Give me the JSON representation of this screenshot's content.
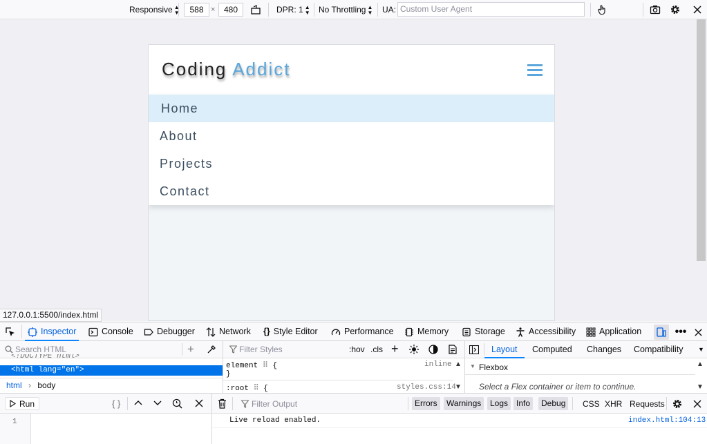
{
  "rdm": {
    "device": "Responsive",
    "width": "588",
    "height": "480",
    "times": "×",
    "dpr": "DPR: 1",
    "throttling": "No Throttling",
    "ua_label": "UA:",
    "ua_placeholder": "Custom User Agent"
  },
  "site": {
    "logo_part1": "Coding",
    "logo_part2": "Addict",
    "nav": [
      "Home",
      "About",
      "Projects",
      "Contact"
    ],
    "active_index": 0,
    "accent": "#5ba7db"
  },
  "status_url": "127.0.0.1:5500/index.html",
  "devtools": {
    "tabs": [
      "Inspector",
      "Console",
      "Debugger",
      "Network",
      "Style Editor",
      "Performance",
      "Memory",
      "Storage",
      "Accessibility",
      "Application"
    ],
    "selected_tab": "Inspector",
    "inspector": {
      "search_placeholder": "Search HTML",
      "markup_doctype": "<!DOCTYPE html>",
      "markup_selected": "<html lang=\"en\">",
      "breadcrumb": [
        "html",
        "body"
      ],
      "rules_filter_placeholder": "Filter Styles",
      "hov": ":hov",
      "cls": ".cls",
      "rule1_selector": "element",
      "rule1_open": "{",
      "rule1_close": "}",
      "rule1_source": "inline",
      "rule2_selector": ":root",
      "rule2_open": "{",
      "rule2_source": "styles.css:14",
      "side_tabs": [
        "Layout",
        "Computed",
        "Changes",
        "Compatibility"
      ],
      "selected_side_tab": "Layout",
      "flexbox_title": "Flexbox",
      "flexbox_hint": "Select a Flex container or item to continue."
    },
    "console": {
      "run_label": "Run",
      "braces": "{ }",
      "line_number": "1",
      "filter_placeholder": "Filter Output",
      "levels": [
        "Errors",
        "Warnings",
        "Logs",
        "Info",
        "Debug"
      ],
      "types": [
        "CSS",
        "XHR",
        "Requests"
      ],
      "message": "Live reload enabled.",
      "message_source": "index.html:104:13"
    }
  }
}
